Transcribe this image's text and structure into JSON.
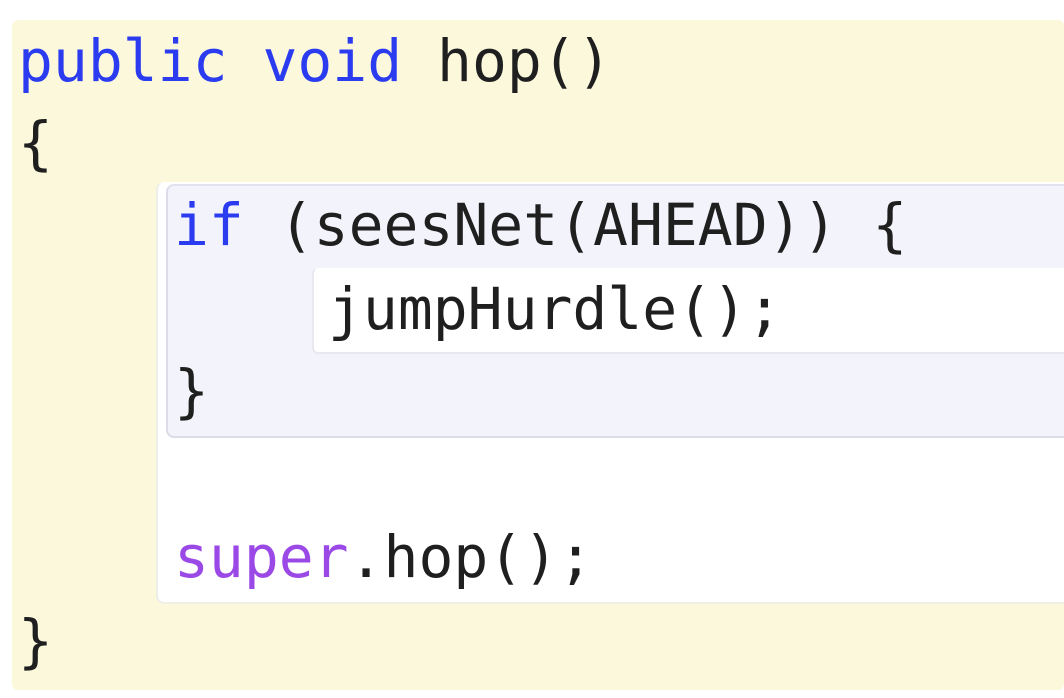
{
  "code": {
    "signature": {
      "kw_public": "public",
      "kw_void": "void",
      "name": "hop()"
    },
    "open_brace": "{",
    "if_line": {
      "kw_if": "if",
      "condition": "(seesNet(AHEAD)) {"
    },
    "call_jump": "jumpHurdle();",
    "if_close": "}",
    "super_line": {
      "kw_super": "super",
      "call": ".hop();"
    },
    "close_brace": "}"
  },
  "colors": {
    "editor_background": "#fbf8dc",
    "keyword_blue": "#2b3cf0",
    "keyword_purple": "#9b49e6",
    "if_block_background": "#f3f3fb",
    "body_background": "#ffffff"
  }
}
